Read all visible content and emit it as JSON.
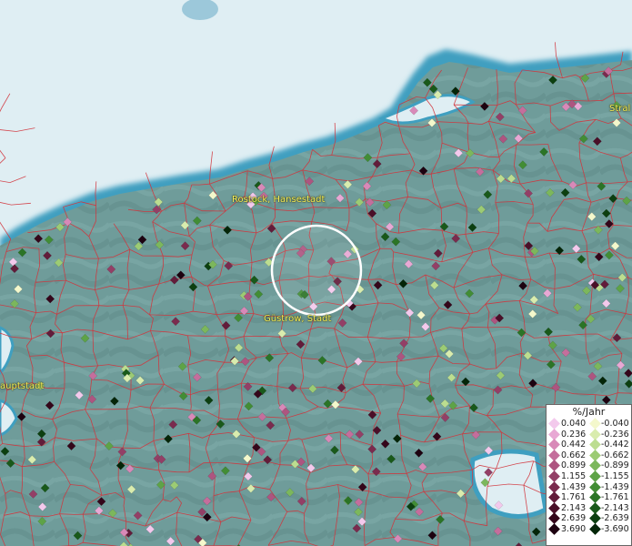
{
  "places": [
    {
      "id": "rostock",
      "label": "Rostock, Hansestadt"
    },
    {
      "id": "guestrow",
      "label": "Güstrow, Stadt"
    },
    {
      "id": "stralsund",
      "label": "Stral"
    },
    {
      "id": "schwerin",
      "label": "auptstadt"
    }
  ],
  "legend": {
    "title": "%/Jahr",
    "positive": [
      {
        "label": "0.040",
        "color": "#f3c9ec"
      },
      {
        "label": "0.236",
        "color": "#e8a8d4"
      },
      {
        "label": "0.442",
        "color": "#d889b8"
      },
      {
        "label": "0.662",
        "color": "#c46e9c"
      },
      {
        "label": "0.899",
        "color": "#ad5580"
      },
      {
        "label": "1.155",
        "color": "#933f66"
      },
      {
        "label": "1.439",
        "color": "#7a2b4e"
      },
      {
        "label": "1.761",
        "color": "#621c3a"
      },
      {
        "label": "2.143",
        "color": "#4a0f28"
      },
      {
        "label": "2.639",
        "color": "#34061a"
      },
      {
        "label": "3.690",
        "color": "#1d0210"
      }
    ],
    "negative": [
      {
        "label": "-0.040",
        "color": "#f4f8cc"
      },
      {
        "label": "-0.236",
        "color": "#d9ecae"
      },
      {
        "label": "-0.442",
        "color": "#bcdd90"
      },
      {
        "label": "-0.662",
        "color": "#9ccb74"
      },
      {
        "label": "-0.899",
        "color": "#7cb75c"
      },
      {
        "label": "-1.155",
        "color": "#5ea347"
      },
      {
        "label": "-1.439",
        "color": "#428d35"
      },
      {
        "label": "-1.761",
        "color": "#2b7426"
      },
      {
        "label": "-2.143",
        "color": "#19591a"
      },
      {
        "label": "-2.639",
        "color": "#0c3f10"
      },
      {
        "label": "-3.690",
        "color": "#042508"
      }
    ]
  },
  "colors": {
    "sea": "#dfeef3",
    "coast": "#3f9fc0",
    "land": "#6f9c9a",
    "boundary": "#d2343c",
    "place_label": "#f4f05a",
    "highlight_ring": "#ffffff"
  }
}
